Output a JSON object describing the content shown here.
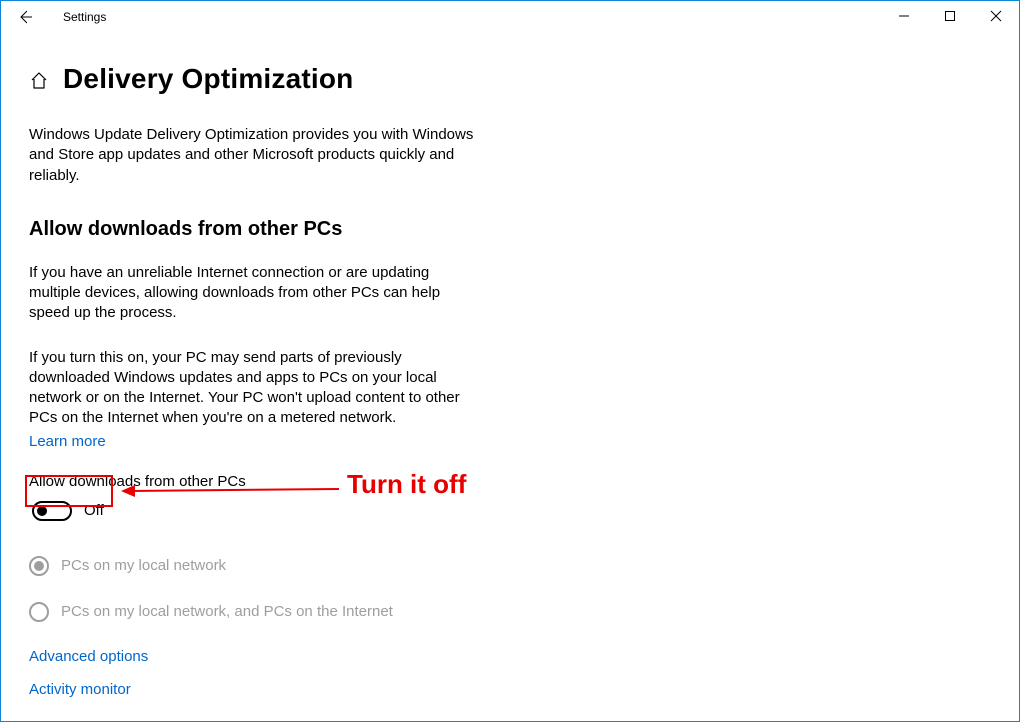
{
  "titlebar": {
    "app_title": "Settings"
  },
  "page": {
    "title": "Delivery Optimization",
    "intro": "Windows Update Delivery Optimization provides you with Windows and Store app updates and other Microsoft products quickly and reliably.",
    "section_heading": "Allow downloads from other PCs",
    "para1": "If you have an unreliable Internet connection or are updating multiple devices, allowing downloads from other PCs can help speed up the process.",
    "para2": "If you turn this on, your PC may send parts of previously downloaded Windows updates and apps to PCs on your local network or on the Internet. Your PC won't upload content to other PCs on the Internet when you're on a metered network.",
    "learn_more": "Learn more",
    "toggle_label": "Allow downloads from other PCs",
    "toggle_state": "Off",
    "radio1": "PCs on my local network",
    "radio2": "PCs on my local network, and PCs on the Internet",
    "advanced_options": "Advanced options",
    "activity_monitor": "Activity monitor"
  },
  "annotation": {
    "text": "Turn it off"
  }
}
